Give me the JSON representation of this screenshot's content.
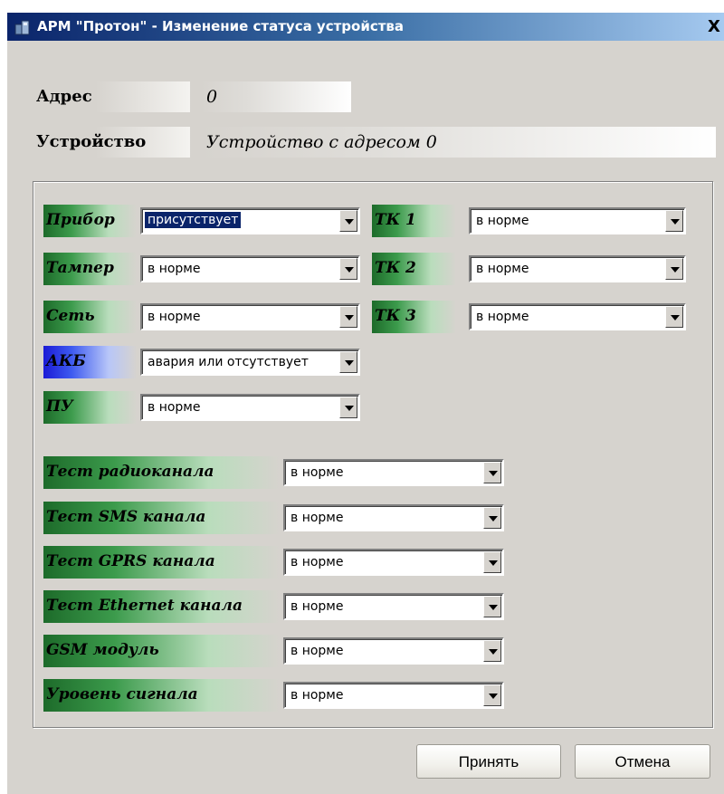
{
  "window": {
    "title": "АРМ \"Протон\" - Изменение статуса устройства",
    "close_label": "X"
  },
  "header": {
    "address_label": "Адрес",
    "address_value": "0",
    "device_label": "Устройство",
    "device_value": "Устройство с адресом 0"
  },
  "status_rows": [
    {
      "label": "Прибор",
      "value": "присутствует"
    },
    {
      "label": "Тампер",
      "value": "в норме"
    },
    {
      "label": "Сеть",
      "value": "в норме"
    },
    {
      "label": "АКБ",
      "value": "авария или отсутствует"
    },
    {
      "label": "ПУ",
      "value": "в норме"
    }
  ],
  "tk_rows": [
    {
      "label": "ТК 1",
      "value": "в норме"
    },
    {
      "label": "ТК 2",
      "value": "в норме"
    },
    {
      "label": "ТК 3",
      "value": "в норме"
    }
  ],
  "test_rows": [
    {
      "label": "Тест радиоканала",
      "value": "в норме"
    },
    {
      "label": "Тест SMS канала",
      "value": "в норме"
    },
    {
      "label": "Тест GPRS канала",
      "value": "в норме"
    },
    {
      "label": "Тест Ethernet канала",
      "value": "в норме"
    },
    {
      "label": "GSM модуль",
      "value": "в норме"
    },
    {
      "label": "Уровень сигнала",
      "value": "в норме"
    }
  ],
  "buttons": {
    "accept": "Принять",
    "cancel": "Отмена"
  },
  "icons": {
    "app": "app-device-icon",
    "dropdown": "chevron-down-icon",
    "close": "close-icon"
  },
  "colors": {
    "label_green": "#1d6b2a",
    "label_blue": "#1b1bd6",
    "selection": "#0a246a"
  }
}
